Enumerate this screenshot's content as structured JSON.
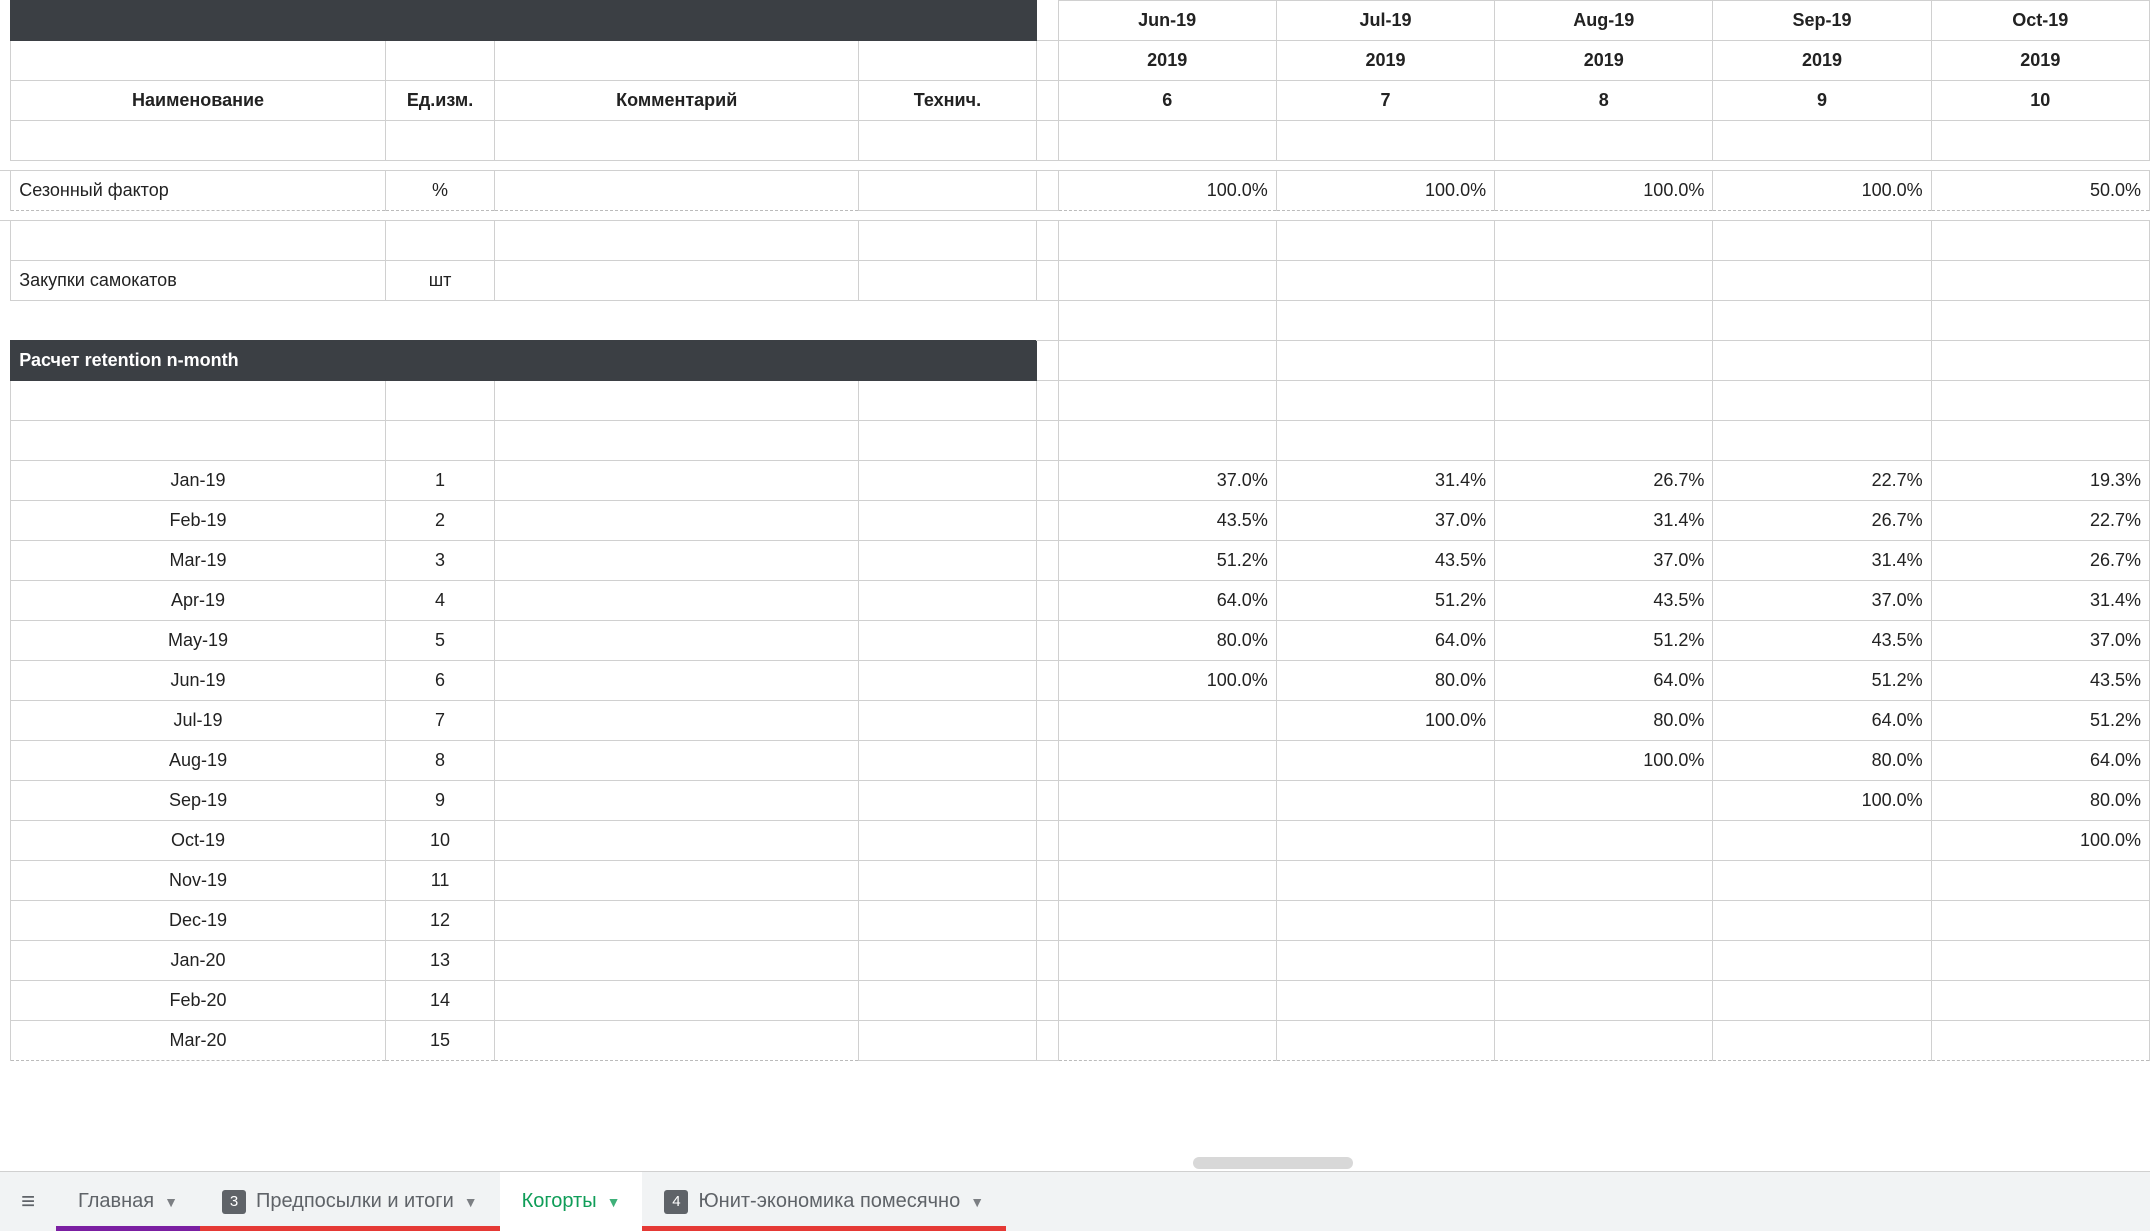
{
  "months": {
    "labels": [
      "Jun-19",
      "Jul-19",
      "Aug-19",
      "Sep-19",
      "Oct-19"
    ],
    "year": [
      "2019",
      "2019",
      "2019",
      "2019",
      "2019"
    ],
    "index": [
      "6",
      "7",
      "8",
      "9",
      "10"
    ]
  },
  "head": {
    "name": "Наименование",
    "unit": "Ед.изм.",
    "comment": "Комментарий",
    "tech": "Технич."
  },
  "season": {
    "label": "Сезонный фактор",
    "unit": "%",
    "values": [
      "100.0%",
      "100.0%",
      "100.0%",
      "100.0%",
      "50.0%"
    ]
  },
  "purchase": {
    "label": "Закупки самокатов",
    "unit": "шт"
  },
  "section": {
    "retention": "Расчет retention n-month"
  },
  "retention_rows": [
    {
      "label": "Jan-19",
      "n": "1",
      "v": [
        "37.0%",
        "31.4%",
        "26.7%",
        "22.7%",
        "19.3%"
      ]
    },
    {
      "label": "Feb-19",
      "n": "2",
      "v": [
        "43.5%",
        "37.0%",
        "31.4%",
        "26.7%",
        "22.7%"
      ]
    },
    {
      "label": "Mar-19",
      "n": "3",
      "v": [
        "51.2%",
        "43.5%",
        "37.0%",
        "31.4%",
        "26.7%"
      ]
    },
    {
      "label": "Apr-19",
      "n": "4",
      "v": [
        "64.0%",
        "51.2%",
        "43.5%",
        "37.0%",
        "31.4%"
      ]
    },
    {
      "label": "May-19",
      "n": "5",
      "v": [
        "80.0%",
        "64.0%",
        "51.2%",
        "43.5%",
        "37.0%"
      ]
    },
    {
      "label": "Jun-19",
      "n": "6",
      "v": [
        "100.0%",
        "80.0%",
        "64.0%",
        "51.2%",
        "43.5%"
      ]
    },
    {
      "label": "Jul-19",
      "n": "7",
      "v": [
        "",
        "100.0%",
        "80.0%",
        "64.0%",
        "51.2%"
      ]
    },
    {
      "label": "Aug-19",
      "n": "8",
      "v": [
        "",
        "",
        "100.0%",
        "80.0%",
        "64.0%"
      ]
    },
    {
      "label": "Sep-19",
      "n": "9",
      "v": [
        "",
        "",
        "",
        "100.0%",
        "80.0%"
      ]
    },
    {
      "label": "Oct-19",
      "n": "10",
      "v": [
        "",
        "",
        "",
        "",
        "100.0%"
      ]
    },
    {
      "label": "Nov-19",
      "n": "11",
      "v": [
        "",
        "",
        "",
        "",
        ""
      ]
    },
    {
      "label": "Dec-19",
      "n": "12",
      "v": [
        "",
        "",
        "",
        "",
        ""
      ]
    },
    {
      "label": "Jan-20",
      "n": "13",
      "v": [
        "",
        "",
        "",
        "",
        ""
      ]
    },
    {
      "label": "Feb-20",
      "n": "14",
      "v": [
        "",
        "",
        "",
        "",
        ""
      ]
    },
    {
      "label": "Mar-20",
      "n": "15",
      "v": [
        "",
        "",
        "",
        "",
        ""
      ]
    }
  ],
  "tabs": {
    "main": "Главная",
    "pre": "Предпосылки и итоги",
    "coh": "Когорты",
    "unit": "Юнит-экономика помесячно",
    "badge_pre": "3",
    "badge_unit": "4"
  }
}
